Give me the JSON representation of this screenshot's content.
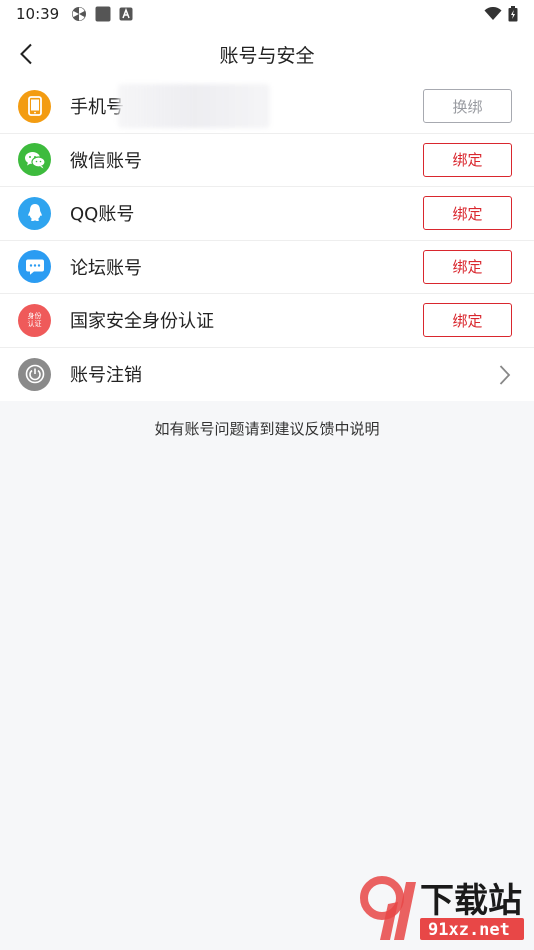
{
  "status_bar": {
    "time": "10:39",
    "icons": [
      "pinwheel-icon",
      "square-app-icon",
      "a-badge-icon"
    ],
    "right_icons": [
      "wifi-icon",
      "battery-icon"
    ]
  },
  "header": {
    "title": "账号与安全",
    "back_icon": "chevron-left-icon"
  },
  "rows": [
    {
      "label": "手机号",
      "icon": "phone-icon",
      "icon_color": "#f39c12",
      "button": "换绑",
      "button_style": "grey"
    },
    {
      "label": "微信账号",
      "icon": "wechat-icon",
      "icon_color": "#3dbb3d",
      "button": "绑定",
      "button_style": "red"
    },
    {
      "label": "QQ账号",
      "icon": "qq-icon",
      "icon_color": "#2fa4ef",
      "button": "绑定",
      "button_style": "red"
    },
    {
      "label": "论坛账号",
      "icon": "chat-bubble-icon",
      "icon_color": "#2b9cf2",
      "button": "绑定",
      "button_style": "red"
    },
    {
      "label": "国家安全身份认证",
      "icon": "id-auth-icon",
      "icon_color": "#ef5a5a",
      "icon_text": [
        "身份",
        "认证"
      ],
      "button": "绑定",
      "button_style": "red"
    },
    {
      "label": "账号注销",
      "icon": "power-icon",
      "icon_color": "#8a8a8a",
      "trailing": "chevron-right-icon"
    }
  ],
  "note": "如有账号问题请到建议反馈中说明",
  "watermark": {
    "main": "下载站",
    "sub": "91xz.net"
  },
  "colors": {
    "accent_red": "#d9272e",
    "grey_button": "#a7a9b0",
    "background": "#f6f7f9"
  }
}
